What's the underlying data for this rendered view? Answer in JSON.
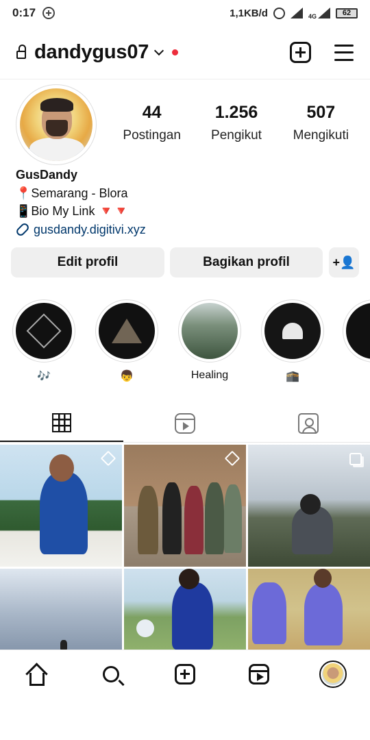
{
  "status_bar": {
    "time": "0:17",
    "speed": "1,1KB/d",
    "network": "4G",
    "battery": "62"
  },
  "header": {
    "username": "dandygus07"
  },
  "profile": {
    "stats": [
      {
        "value": "44",
        "label": "Postingan"
      },
      {
        "value": "1.256",
        "label": "Pengikut"
      },
      {
        "value": "507",
        "label": "Mengikuti"
      }
    ],
    "name": "GusDandy",
    "bio_line1": "📍Semarang - Blora",
    "bio_line2": "📱Bio My Link 🔻🔻",
    "link": "gusdandy.digitivi.xyz"
  },
  "buttons": {
    "edit": "Edit profil",
    "share": "Bagikan profil",
    "add_person": "+👤"
  },
  "highlights": [
    {
      "label": "🎶",
      "icon": "hexagon-logo"
    },
    {
      "label": "👦",
      "icon": "triangle-art"
    },
    {
      "label": "Healing",
      "icon": "forest-photo"
    },
    {
      "label": "🕋",
      "icon": "mosque-logo"
    },
    {
      "label": "",
      "icon": "partial"
    }
  ],
  "tabs": [
    "grid",
    "reels",
    "tagged"
  ],
  "posts": [
    {
      "pinned": true
    },
    {
      "pinned": true
    },
    {
      "multi": true
    },
    {},
    {},
    {}
  ],
  "bottom_nav": [
    "home",
    "search",
    "create",
    "reels",
    "profile"
  ]
}
